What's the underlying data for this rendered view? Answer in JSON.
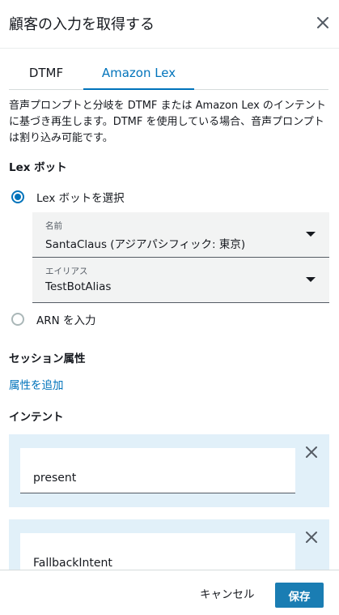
{
  "header": {
    "title": "顧客の入力を取得する",
    "close_icon": "close-icon"
  },
  "tabs": [
    {
      "label": "DTMF",
      "active": false
    },
    {
      "label": "Amazon Lex",
      "active": true
    }
  ],
  "description": "音声プロンプトと分岐を DTMF または Amazon Lex のインテントに基づき再生します。DTMF を使用している場合、音声プロンプトは割り込み可能です。",
  "lex_bot": {
    "section_title": "Lex ボット",
    "option_select": {
      "label": "Lex ボットを選択",
      "checked": true
    },
    "name_select": {
      "caption": "名前",
      "value": "SantaClaus (アジアパシフィック: 東京)"
    },
    "alias_select": {
      "caption": "エイリアス",
      "value": "TestBotAlias"
    },
    "option_arn": {
      "label": "ARN を入力",
      "checked": false
    }
  },
  "session": {
    "section_title": "セッション属性",
    "add_link": "属性を追加"
  },
  "intents": {
    "section_title": "インテント",
    "items": [
      {
        "value": "present"
      },
      {
        "value": "FallbackIntent"
      }
    ]
  },
  "footer": {
    "cancel_label": "キャンセル",
    "save_label": "保存"
  },
  "colors": {
    "accent": "#0073bb",
    "intent_bg": "#e1f0f9",
    "save_button": "#1a7db3"
  }
}
